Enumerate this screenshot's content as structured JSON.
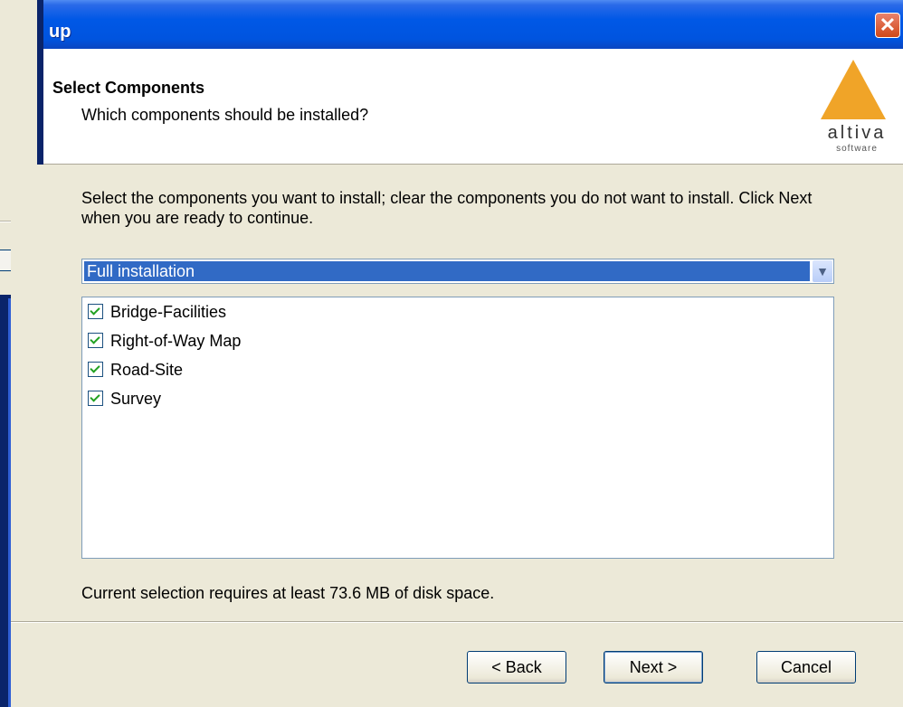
{
  "window": {
    "title": "up",
    "close_label": "✕"
  },
  "header": {
    "title": "Select Components",
    "subtitle": "Which components should be installed?",
    "logo_word": "altiva",
    "logo_sub": "software",
    "logo_color": "#f0a428"
  },
  "instructions": "Select the components you want to install; clear the components you do not want to install. Click Next when you are ready to continue.",
  "installation_type": {
    "selected": "Full installation"
  },
  "components": [
    {
      "label": "Bridge-Facilities",
      "checked": true
    },
    {
      "label": "Right-of-Way Map",
      "checked": true
    },
    {
      "label": "Road-Site",
      "checked": true
    },
    {
      "label": "Survey",
      "checked": true
    }
  ],
  "disk_space_text": "Current selection requires at least 73.6 MB of disk space.",
  "buttons": {
    "back": "< Back",
    "next": "Next >",
    "cancel": "Cancel"
  },
  "colors": {
    "titlebar": "#0058e6",
    "selection": "#316ac5",
    "face": "#ece9d8"
  }
}
